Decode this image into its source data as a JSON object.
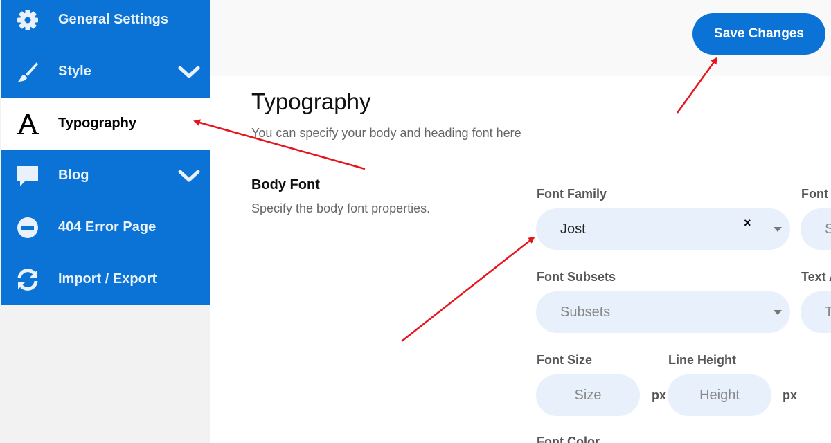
{
  "sidebar": {
    "items": [
      {
        "label": "General Settings",
        "icon": "gear-icon"
      },
      {
        "label": "Style",
        "icon": "brush-icon",
        "has_chevron": true
      },
      {
        "label": "Typography",
        "icon": "typography-icon",
        "active": true
      },
      {
        "label": "Blog",
        "icon": "comment-icon",
        "has_chevron": true
      },
      {
        "label": "404 Error Page",
        "icon": "minus-circle-icon"
      },
      {
        "label": "Import / Export",
        "icon": "sync-icon"
      }
    ]
  },
  "header": {
    "save_label": "Save Changes"
  },
  "main": {
    "title": "Typography",
    "description": "You can specify your body and heading font here",
    "body_font": {
      "title": "Body Font",
      "description": "Specify the body font properties.",
      "font_family_label": "Font Family",
      "font_family_value": "Jost",
      "font_weight_label": "Font",
      "font_weight_placeholder": "S",
      "font_subsets_label": "Font Subsets",
      "font_subsets_placeholder": "Subsets",
      "text_align_label": "Text A",
      "text_align_placeholder": "T",
      "font_size_label": "Font Size",
      "font_size_placeholder": "Size",
      "line_height_label": "Line Height",
      "line_height_placeholder": "Height",
      "unit": "px",
      "font_color_label": "Font Color"
    }
  },
  "colors": {
    "accent": "#0b72d6",
    "sidebar_bg": "#f2f2f2",
    "pill_bg": "#e7f0fb",
    "annotation_arrow": "#e8141c"
  }
}
